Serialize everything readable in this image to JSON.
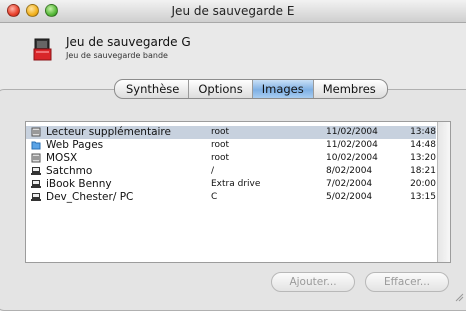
{
  "window": {
    "title": "Jeu de sauvegarde E"
  },
  "header": {
    "name": "Jeu de sauvegarde G",
    "subtitle": "Jeu de sauvegarde bande"
  },
  "tabs": [
    {
      "label": "Synthèse",
      "selected": false
    },
    {
      "label": "Options",
      "selected": false
    },
    {
      "label": "Images",
      "selected": true
    },
    {
      "label": "Membres",
      "selected": false
    }
  ],
  "list": {
    "rows": [
      {
        "icon": "drive-icon",
        "name": "Lecteur supplémentaire",
        "user": "root",
        "date": "11/02/2004",
        "time": "13:48",
        "selected": true
      },
      {
        "icon": "folder-icon",
        "name": "Web Pages",
        "user": "root",
        "date": "11/02/2004",
        "time": "14:48",
        "selected": false
      },
      {
        "icon": "drive-icon",
        "name": "MOSX",
        "user": "root",
        "date": "10/02/2004",
        "time": "13:20",
        "selected": false
      },
      {
        "icon": "client-icon",
        "name": "Satchmo",
        "user": "/",
        "date": "8/02/2004",
        "time": "18:21",
        "selected": false
      },
      {
        "icon": "client-icon",
        "name": "iBook Benny",
        "user": "Extra drive",
        "date": "7/02/2004",
        "time": "20:00",
        "selected": false
      },
      {
        "icon": "client-icon",
        "name": "Dev_Chester/ PC",
        "user": "C",
        "date": "5/02/2004",
        "time": "13:15",
        "selected": false
      }
    ]
  },
  "buttons": {
    "add": "Ajouter...",
    "clear": "Effacer..."
  },
  "colors": {
    "selection": "#c7d1de",
    "tab_selected": "#7fb0e4"
  }
}
